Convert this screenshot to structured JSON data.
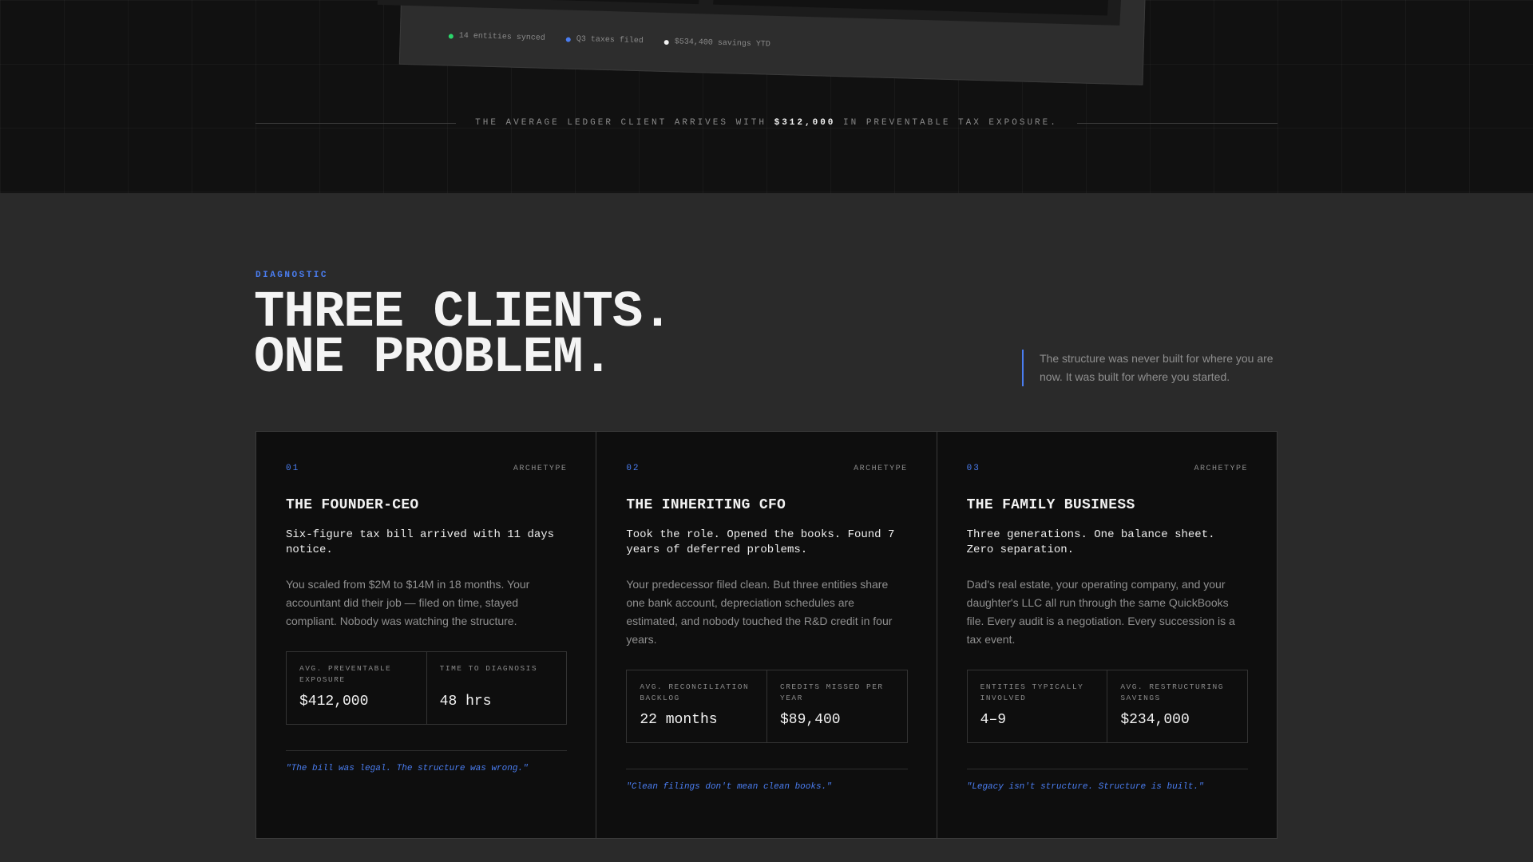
{
  "hero": {
    "status_items": [
      {
        "label": "14 entities synced",
        "color": "#2bd66b"
      },
      {
        "label": "Q3 taxes filed",
        "color": "#4a7df0"
      },
      {
        "label": "$534,400 savings YTD",
        "color": "#f2f2f2"
      }
    ],
    "stat_prefix": "THE AVERAGE LEDGER CLIENT ARRIVES WITH",
    "stat_value": "$312,000",
    "stat_suffix": "IN PREVENTABLE TAX EXPOSURE."
  },
  "diagnostic": {
    "eyebrow": "DIAGNOSTIC",
    "headline_line1": "THREE CLIENTS.",
    "headline_line2": "ONE PROBLEM.",
    "side_quote": "The structure was never built for where you are now. It was built for where you started."
  },
  "cards": [
    {
      "num": "01",
      "tag": "ARCHETYPE",
      "title": "THE FOUNDER-CEO",
      "lede": "Six-figure tax bill arrived with 11 days notice.",
      "body": "You scaled from $2M to $14M in 18 months. Your accountant did their job — filed on time, stayed compliant. Nobody was watching the structure.",
      "metrics": [
        {
          "label": "AVG. PREVENTABLE EXPOSURE",
          "value": "$412,000"
        },
        {
          "label": "TIME TO DIAGNOSIS",
          "value": "48 hrs"
        }
      ],
      "quote": "\"The bill was legal. The structure was wrong.\""
    },
    {
      "num": "02",
      "tag": "ARCHETYPE",
      "title": "THE INHERITING CFO",
      "lede": "Took the role. Opened the books. Found 7 years of deferred problems.",
      "body": "Your predecessor filed clean. But three entities share one bank account, depreciation schedules are estimated, and nobody touched the R&D credit in four years.",
      "metrics": [
        {
          "label": "AVG. RECONCILIATION BACKLOG",
          "value": "22 months"
        },
        {
          "label": "CREDITS MISSED PER YEAR",
          "value": "$89,400"
        }
      ],
      "quote": "\"Clean filings don't mean clean books.\""
    },
    {
      "num": "03",
      "tag": "ARCHETYPE",
      "title": "THE FAMILY BUSINESS",
      "lede": "Three generations. One balance sheet. Zero separation.",
      "body": "Dad's real estate, your operating company, and your daughter's LLC all run through the same QuickBooks file. Every audit is a negotiation. Every succession is a tax event.",
      "metrics": [
        {
          "label": "ENTITIES TYPICALLY INVOLVED",
          "value": "4–9"
        },
        {
          "label": "AVG. RESTRUCTURING SAVINGS",
          "value": "$234,000"
        }
      ],
      "quote": "\"Legacy isn't structure. Structure is built.\""
    }
  ]
}
